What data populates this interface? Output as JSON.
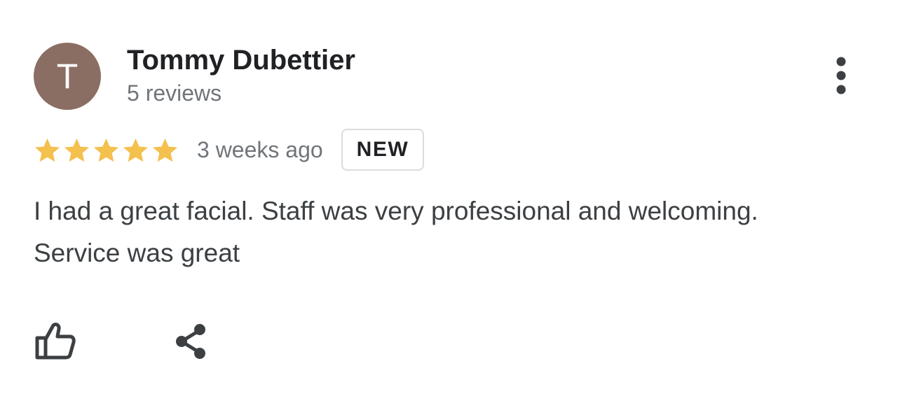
{
  "author": {
    "avatar_initial": "T",
    "avatar_color": "#8b6e63",
    "name": "Tommy Dubettier",
    "review_count": "5 reviews"
  },
  "rating": {
    "stars": 5,
    "max_stars": 5,
    "star_color": "#f4c04e"
  },
  "timestamp": "3 weeks ago",
  "badge": "NEW",
  "review_lines": [
    "I had a great facial. Staff was very professional and welcoming.",
    "Service was great"
  ],
  "icons": {
    "menu": "more-vertical-icon",
    "like": "thumbs-up-icon",
    "share": "share-icon"
  }
}
